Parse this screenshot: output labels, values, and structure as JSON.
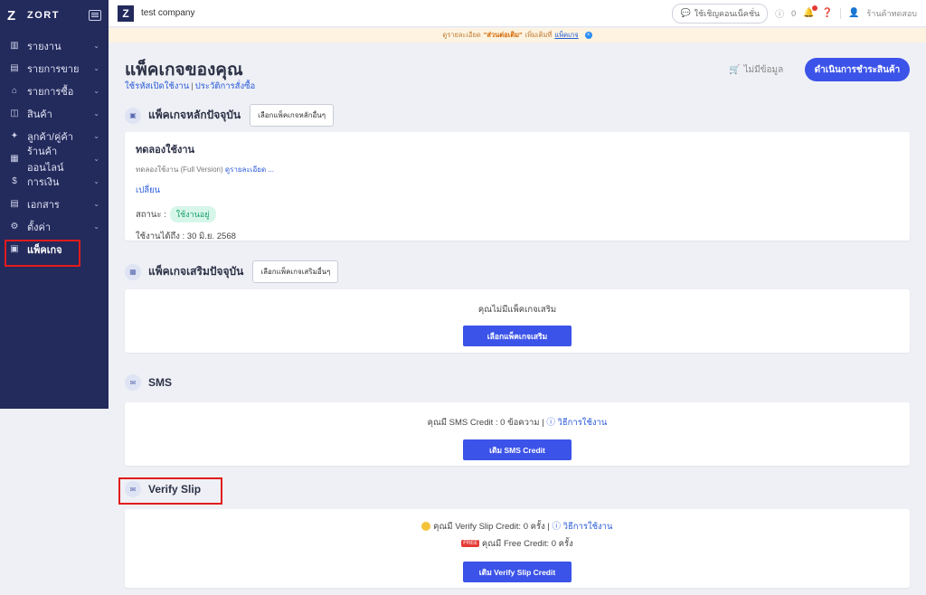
{
  "sidebar": {
    "brand_logo": "Z",
    "brand_name": "ZORT",
    "items": [
      {
        "label": "รายงาน",
        "icon": "chart-icon",
        "glyph": "▥"
      },
      {
        "label": "รายการขาย",
        "icon": "receipt-icon",
        "glyph": "▤"
      },
      {
        "label": "รายการซื้อ",
        "icon": "shop-icon",
        "glyph": "⌂"
      },
      {
        "label": "สินค้า",
        "icon": "box-icon",
        "glyph": "◫"
      },
      {
        "label": "ลูกค้า/คู่ค้า",
        "icon": "handshake-icon",
        "glyph": "✦"
      },
      {
        "label": "ร้านค้าออนไลน์",
        "icon": "store-icon",
        "glyph": "▦"
      },
      {
        "label": "การเงิน",
        "icon": "money-icon",
        "glyph": "$"
      },
      {
        "label": "เอกสาร",
        "icon": "document-icon",
        "glyph": "▤"
      },
      {
        "label": "ตั้งค่า",
        "icon": "gear-icon",
        "glyph": "⚙"
      },
      {
        "label": "แพ็คเกจ",
        "icon": "package-icon",
        "glyph": "▣"
      }
    ]
  },
  "topbar": {
    "company_logo": "Z",
    "company_name": "test company",
    "invite_label": "ใช้เชิญคอนเน็คชั่น",
    "info_count": "0",
    "store_label": "ร้านค้าทดสอบ"
  },
  "announcement": {
    "prefix": "ดูรายละเอียด",
    "highlight": "\"ส่วนต่อเติม\"",
    "middle": "เพิ่มเติมที่",
    "link": "แพ็คเกจ"
  },
  "main": {
    "title": "แพ็คเกจของคุณ",
    "subnav_left": "ใช้รหัสเปิดใช้งาน",
    "subnav_right": "ประวัติการสั่งซื้อ",
    "no_data": "ไม่มีข้อมูล",
    "checkout_label": "ดำเนินการชำระสินค้า"
  },
  "current_package": {
    "title": "แพ็คเกจหลักปัจจุบัน",
    "button": "เลือกแพ็คเกจหลักอื่นๆ",
    "name": "ทดลองใช้งาน",
    "desc": "ทดลองใช้งาน (Full Version)",
    "desc_link": "ดูรายละเอียด ...",
    "change_link": "เปลี่ยน",
    "status_label": "สถานะ :",
    "status_value": "ใช้งานอยู่",
    "expire": "ใช้งานได้ถึง : 30 มิ.ย. 2568"
  },
  "addon_package": {
    "title": "แพ็คเกจเสริมปัจจุบัน",
    "button": "เลือกแพ็คเกจเสริมอื่นๆ",
    "empty_text": "คุณไม่มีแพ็คเกจเสริม",
    "action": "เลือกแพ็คเกจเสริม"
  },
  "sms": {
    "title": "SMS",
    "credit_text": "คุณมี SMS Credit : 0 ข้อความ |",
    "howto": "วิธีการใช้งาน",
    "action": "เติม SMS Credit"
  },
  "verify_slip": {
    "title": "Verify Slip",
    "credit_text": "คุณมี Verify Slip Credit: 0 ครั้ง |",
    "howto": "วิธีการใช้งาน",
    "free_tag": "FREE",
    "free_text": "คุณมี Free Credit: 0 ครั้ง",
    "action": "เติม Verify Slip Credit"
  }
}
